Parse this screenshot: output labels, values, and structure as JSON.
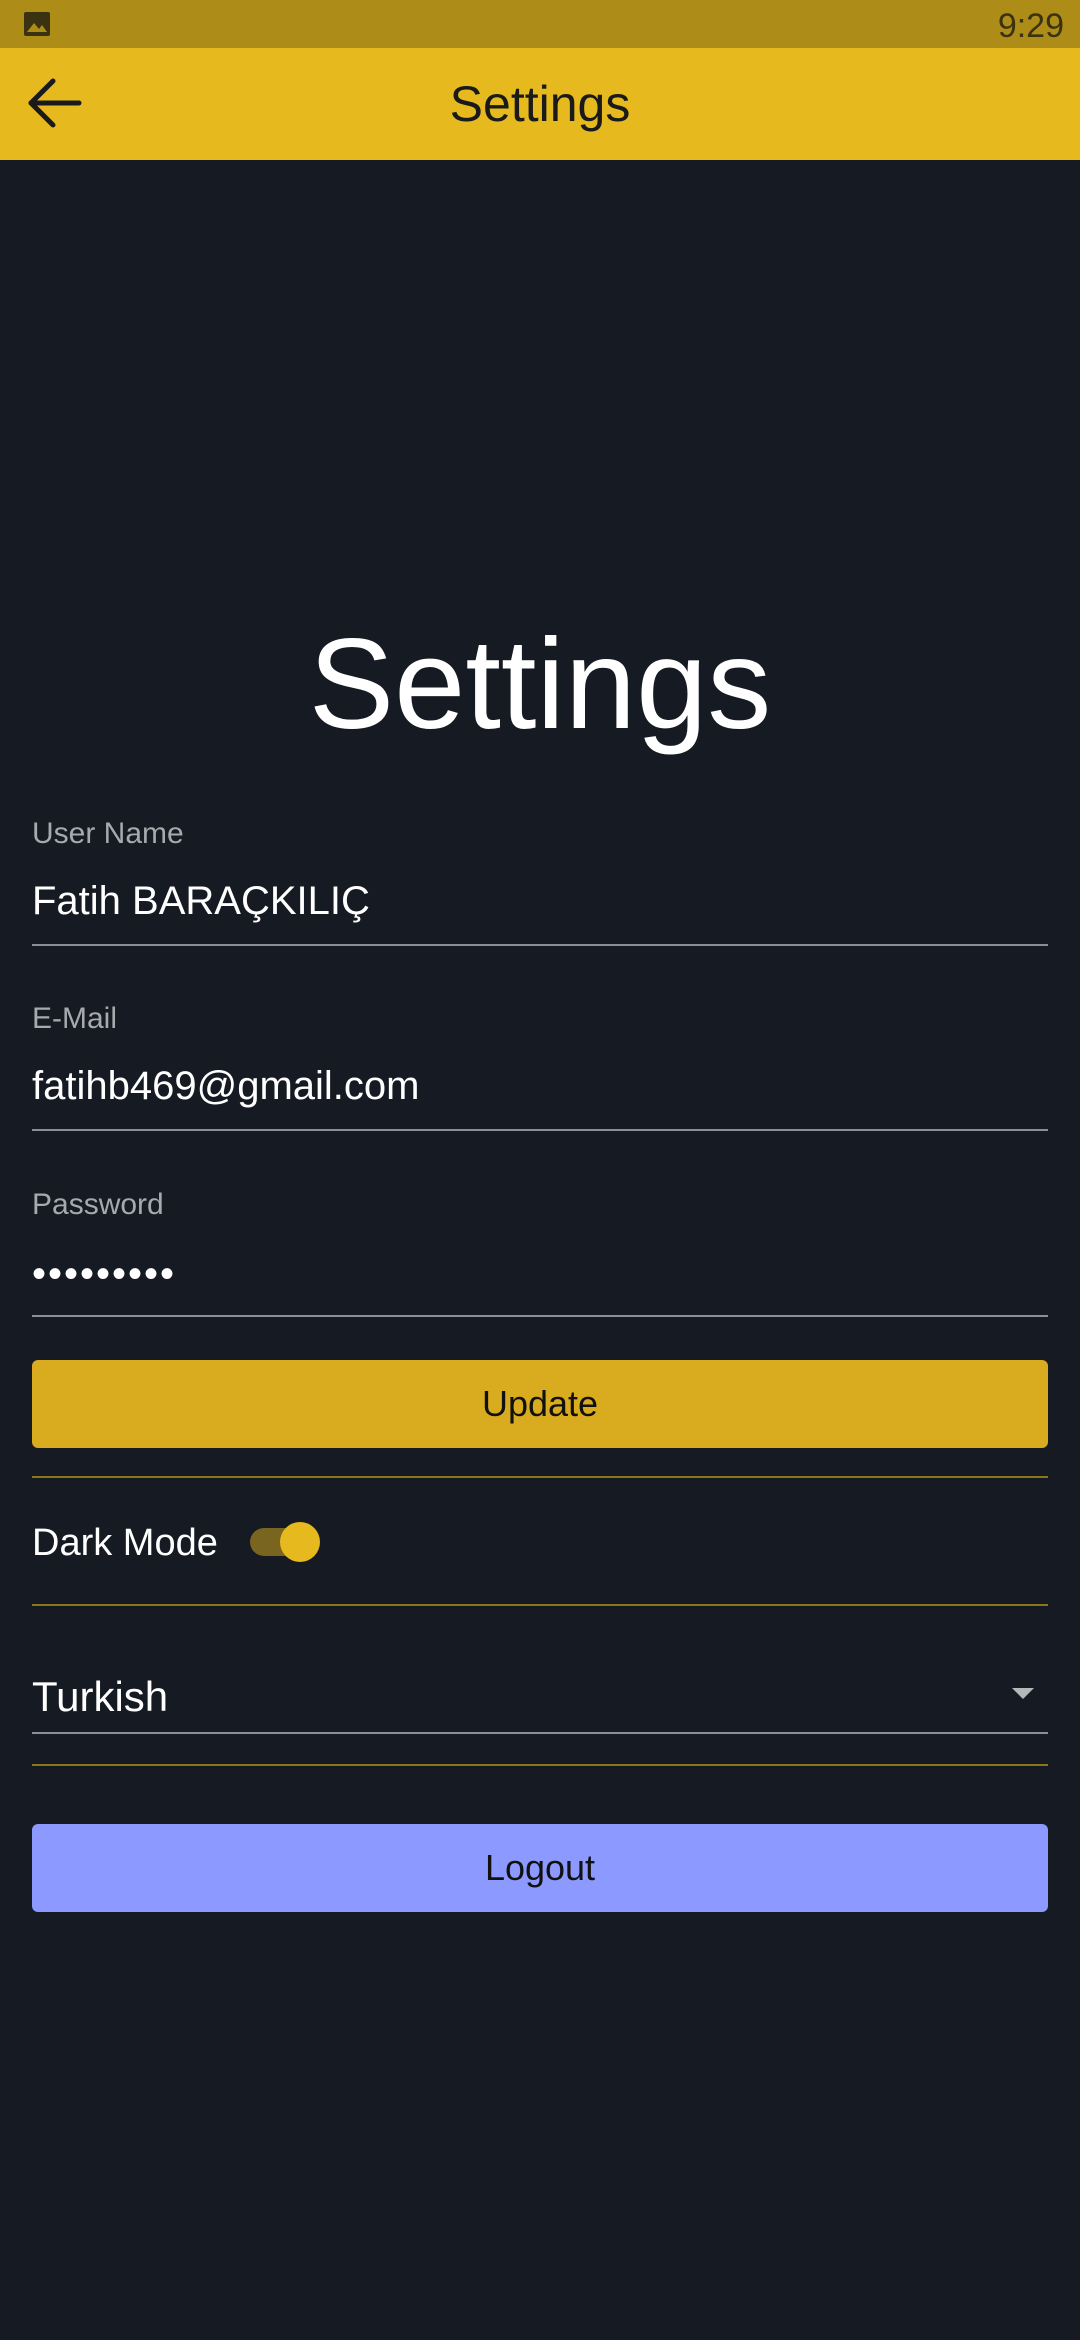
{
  "status_bar": {
    "time": "9:29",
    "notification_icon": "image-icon"
  },
  "app_bar": {
    "back_icon": "arrow-left-icon",
    "title": "Settings"
  },
  "page_title": "Settings",
  "form": {
    "username": {
      "label": "User Name",
      "value": "Fatih BARAÇKILIÇ"
    },
    "email": {
      "label": "E-Mail",
      "value": "fatihb469@gmail.com"
    },
    "password": {
      "label": "Password",
      "value": "•••••••••"
    }
  },
  "buttons": {
    "update": "Update",
    "logout": "Logout"
  },
  "dark_mode": {
    "label": "Dark Mode",
    "enabled": true
  },
  "language": {
    "selected": "Turkish"
  },
  "colors": {
    "background": "#161a22",
    "accent": "#e6b91e",
    "update_button": "#d9ab1f",
    "logout_button": "#8c9aff"
  }
}
